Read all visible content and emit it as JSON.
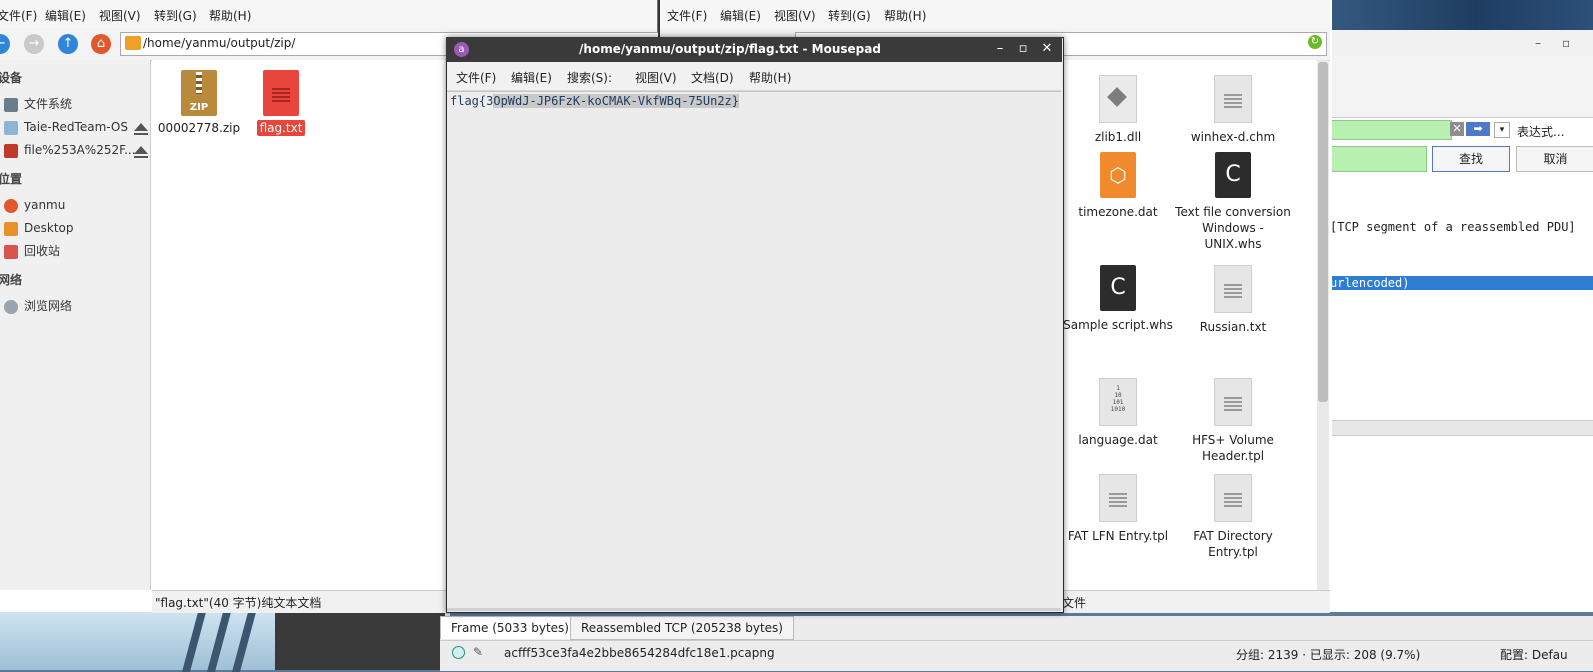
{
  "left_file_manager": {
    "menu": [
      "文件(F)",
      "编辑(E)",
      "视图(V)",
      "转到(G)",
      "帮助(H)"
    ],
    "path": "/home/yanmu/output/zip/",
    "sidebar": {
      "heading_devices": "设备",
      "devices": [
        "文件系统",
        "Taie-RedTeam-OS",
        "file%253A%252F..."
      ],
      "heading_places": "位置",
      "places": [
        "yanmu",
        "Desktop",
        "回收站"
      ],
      "heading_network": "网络",
      "network": [
        "浏览网络"
      ]
    },
    "files": [
      {
        "name": "00002778.zip",
        "icon": "zip-icon",
        "badge": "ZIP"
      },
      {
        "name": "flag.txt",
        "icon": "text-file-icon"
      }
    ],
    "status": "\"flag.txt\"(40 字节)纯文本文档"
  },
  "right_file_manager": {
    "menu": [
      "文件(F)",
      "编辑(E)",
      "视图(V)",
      "转到(G)",
      "帮助(H)"
    ],
    "files": [
      {
        "name": "zlib1.dll"
      },
      {
        "name": "winhex-d.chm"
      },
      {
        "name": "timezone.dat"
      },
      {
        "name": "Text file conversion Windows - UNIX.whs"
      },
      {
        "name": "Sample script.whs"
      },
      {
        "name": "Russian.txt"
      },
      {
        "name": "language.dat",
        "icon_text": "1\n10\n101\n1010"
      },
      {
        "name": "HFS+ Volume Header.tpl"
      },
      {
        "name": "FAT LFN Entry.tpl"
      },
      {
        "name": "FAT Directory Entry.tpl"
      }
    ],
    "status": "文件"
  },
  "mousepad": {
    "title": "/home/yanmu/output/zip/flag.txt - Mousepad",
    "app_icon_letter": "a",
    "menu": [
      "文件(F)",
      "编辑(E)",
      "搜索(S):",
      "视图(V)",
      "文档(D)",
      "帮助(H)"
    ],
    "content_prefix": "flag{3",
    "content_selected": "OpWdJ-JP6FzK-koCMAK-VkfWBq-75Un2z}"
  },
  "wireshark": {
    "expression_label": "表达式...",
    "find_label": "查找",
    "cancel_label": "取消",
    "packet_info": "[TCP segment of a reassembled PDU]",
    "selected_row": "urlencoded)",
    "tabs": [
      "Frame (5033 bytes)",
      "Reassembled TCP (205238 bytes)"
    ],
    "file": "acfff53ce3fa4e2bbe8654284dfc18e1.pcapng",
    "packet_stats": "分组: 2139 · 已显示: 208 (9.7%)",
    "profile": "配置: Defau"
  }
}
